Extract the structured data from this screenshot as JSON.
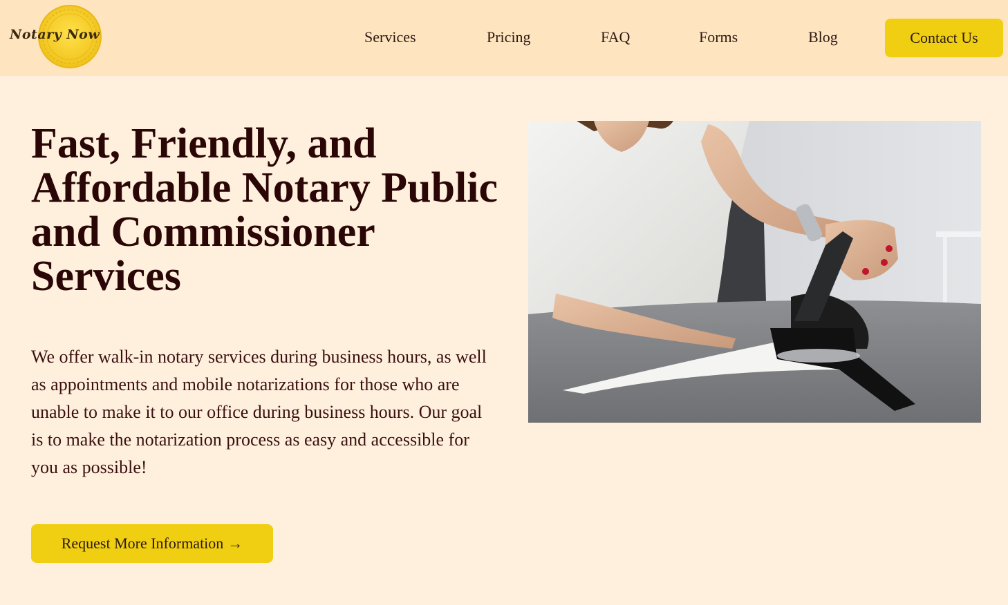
{
  "brand": {
    "logo_text": "Notary Now"
  },
  "nav": {
    "items": [
      {
        "label": "Services"
      },
      {
        "label": "Pricing"
      },
      {
        "label": "FAQ"
      },
      {
        "label": "Forms"
      },
      {
        "label": "Blog"
      }
    ],
    "contact_label": "Contact Us"
  },
  "hero": {
    "title": "Fast, Friendly, and Affordable Notary Public and Commissioner Services",
    "body": "We offer walk-in notary services during business hours, as well as appointments and mobile notarizations for those who are unable to make it to our office during business hours. Our goal is to make the notarization process as easy and accessible for you as possible!",
    "cta_label": "Request More Information",
    "cta_arrow": "→"
  },
  "colors": {
    "page_background": "#fff0dd",
    "header_background": "#ffe4c0",
    "accent": "#f0cf12",
    "heading_text": "#2b0606"
  }
}
